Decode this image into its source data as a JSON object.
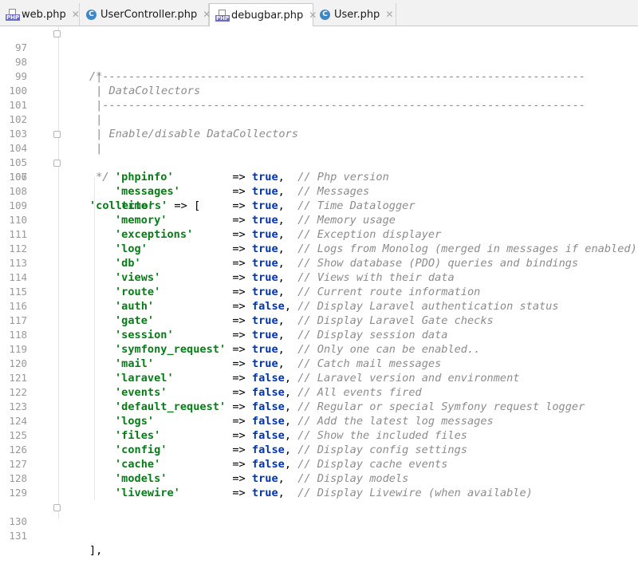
{
  "tabs": [
    {
      "label": "web.php",
      "icon": "php-file-icon",
      "active": false
    },
    {
      "label": "UserController.php",
      "icon": "class-icon",
      "active": false
    },
    {
      "label": "debugbar.php",
      "icon": "php-file-icon",
      "active": true
    },
    {
      "label": "User.php",
      "icon": "class-icon",
      "active": false
    }
  ],
  "php_badge": "PHP",
  "class_badge": "C",
  "close_glyph": "✕",
  "comment_lines": [
    {
      "num": "97",
      "text": "/*"
    },
    {
      "num": "98",
      "text": " |--------------------------------------------------------------------------"
    },
    {
      "num": "99",
      "text": " | DataCollectors"
    },
    {
      "num": "100",
      "text": " |--------------------------------------------------------------------------"
    },
    {
      "num": "101",
      "text": " |"
    },
    {
      "num": "102",
      "text": " | Enable/disable DataCollectors"
    },
    {
      "num": "103",
      "text": " |"
    },
    {
      "num": "104",
      "text": " */"
    },
    {
      "num": "105",
      "text": ""
    }
  ],
  "open_line": {
    "num": "106",
    "key": "'collectors'",
    "rest": " => ["
  },
  "collectors": [
    {
      "num": "107",
      "key": "'phpinfo'",
      "pad": "         ",
      "value": "true",
      "sep": ",  ",
      "comment": "// Php version"
    },
    {
      "num": "108",
      "key": "'messages'",
      "pad": "        ",
      "value": "true",
      "sep": ",  ",
      "comment": "// Messages"
    },
    {
      "num": "109",
      "key": "'time'",
      "pad": "            ",
      "value": "true",
      "sep": ",  ",
      "comment": "// Time Datalogger"
    },
    {
      "num": "110",
      "key": "'memory'",
      "pad": "          ",
      "value": "true",
      "sep": ",  ",
      "comment": "// Memory usage"
    },
    {
      "num": "111",
      "key": "'exceptions'",
      "pad": "      ",
      "value": "true",
      "sep": ",  ",
      "comment": "// Exception displayer"
    },
    {
      "num": "112",
      "key": "'log'",
      "pad": "             ",
      "value": "true",
      "sep": ",  ",
      "comment": "// Logs from Monolog (merged in messages if enabled)"
    },
    {
      "num": "113",
      "key": "'db'",
      "pad": "              ",
      "value": "true",
      "sep": ",  ",
      "comment": "// Show database (PDO) queries and bindings"
    },
    {
      "num": "114",
      "key": "'views'",
      "pad": "           ",
      "value": "true",
      "sep": ",  ",
      "comment": "// Views with their data"
    },
    {
      "num": "115",
      "key": "'route'",
      "pad": "           ",
      "value": "true",
      "sep": ",  ",
      "comment": "// Current route information"
    },
    {
      "num": "116",
      "key": "'auth'",
      "pad": "            ",
      "value": "false",
      "sep": ", ",
      "comment": "// Display Laravel authentication status"
    },
    {
      "num": "117",
      "key": "'gate'",
      "pad": "            ",
      "value": "true",
      "sep": ",  ",
      "comment": "// Display Laravel Gate checks"
    },
    {
      "num": "118",
      "key": "'session'",
      "pad": "         ",
      "value": "true",
      "sep": ",  ",
      "comment": "// Display session data"
    },
    {
      "num": "119",
      "key": "'symfony_request'",
      "pad": " ",
      "value": "true",
      "sep": ",  ",
      "comment": "// Only one can be enabled.."
    },
    {
      "num": "120",
      "key": "'mail'",
      "pad": "            ",
      "value": "true",
      "sep": ",  ",
      "comment": "// Catch mail messages"
    },
    {
      "num": "121",
      "key": "'laravel'",
      "pad": "         ",
      "value": "false",
      "sep": ", ",
      "comment": "// Laravel version and environment"
    },
    {
      "num": "122",
      "key": "'events'",
      "pad": "          ",
      "value": "false",
      "sep": ", ",
      "comment": "// All events fired"
    },
    {
      "num": "123",
      "key": "'default_request'",
      "pad": " ",
      "value": "false",
      "sep": ", ",
      "comment": "// Regular or special Symfony request logger"
    },
    {
      "num": "124",
      "key": "'logs'",
      "pad": "            ",
      "value": "false",
      "sep": ", ",
      "comment": "// Add the latest log messages"
    },
    {
      "num": "125",
      "key": "'files'",
      "pad": "           ",
      "value": "false",
      "sep": ", ",
      "comment": "// Show the included files"
    },
    {
      "num": "126",
      "key": "'config'",
      "pad": "          ",
      "value": "false",
      "sep": ", ",
      "comment": "// Display config settings"
    },
    {
      "num": "127",
      "key": "'cache'",
      "pad": "           ",
      "value": "false",
      "sep": ", ",
      "comment": "// Display cache events"
    },
    {
      "num": "128",
      "key": "'models'",
      "pad": "          ",
      "value": "true",
      "sep": ",  ",
      "comment": "// Display models"
    },
    {
      "num": "129",
      "key": "'livewire'",
      "pad": "        ",
      "value": "true",
      "sep": ",  ",
      "comment": "// Display Livewire (when available)"
    }
  ],
  "close_line": {
    "num": "130",
    "text": "],"
  },
  "tail_line": {
    "num": "131",
    "text": ""
  }
}
